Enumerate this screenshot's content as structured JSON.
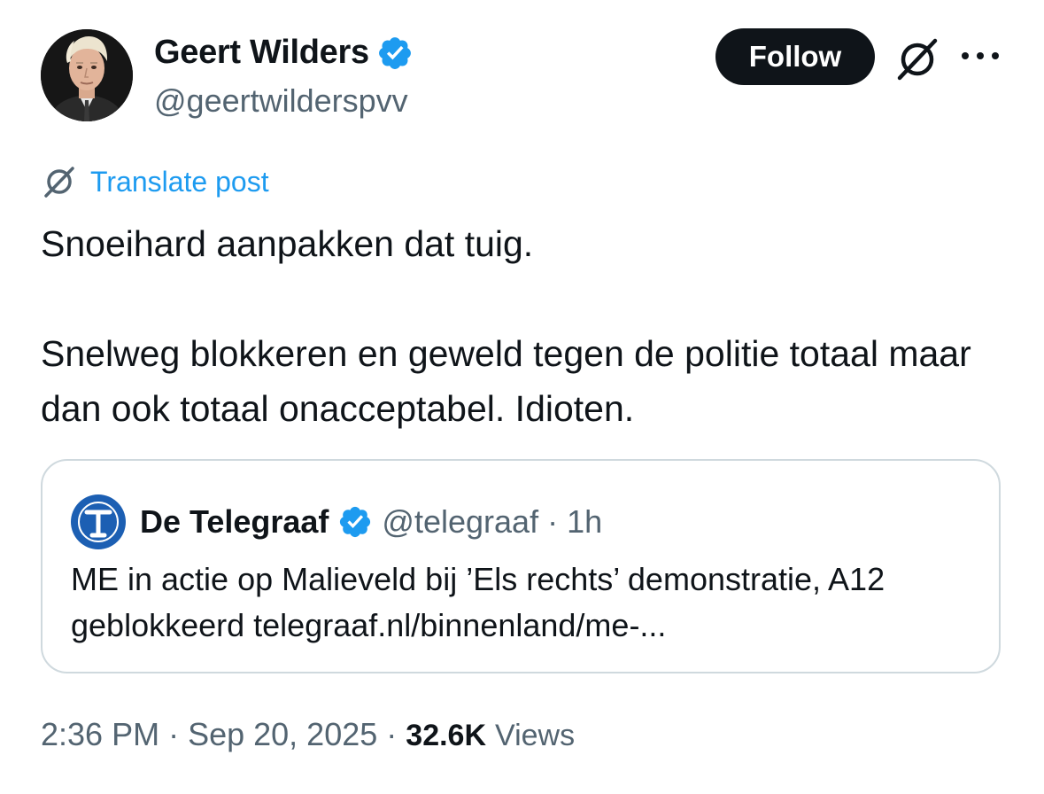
{
  "author": {
    "name": "Geert Wilders",
    "handle": "@geertwilderspvv"
  },
  "actions": {
    "follow_label": "Follow"
  },
  "icons": {
    "verified": "verified-badge-icon",
    "grok": "grok-icon",
    "more": "more-icon",
    "translate": "translate-icon"
  },
  "translate": {
    "label": "Translate post"
  },
  "post": {
    "line1": "Snoeihard aanpakken dat tuig.",
    "line2": "Snelweg blokkeren en geweld tegen de politie totaal maar dan ook totaal onacceptabel. Idioten."
  },
  "quoted": {
    "name": "De Telegraaf",
    "handle": "@telegraaf",
    "separator": "·",
    "time": "1h",
    "text": "ME in actie op Malieveld bij ’Els rechts’ demonstratie, A12 geblokkeerd telegraaf.nl/binnenland/me-..."
  },
  "meta": {
    "time": "2:36 PM",
    "sep1": "·",
    "date": "Sep 20, 2025",
    "sep2": "·",
    "views_count": "32.6K",
    "views_label": "Views"
  },
  "colors": {
    "text": "#0f1419",
    "secondary": "#536471",
    "link": "#1d9bf0",
    "verified": "#1d9bf0",
    "border": "#cfd9de",
    "button_bg": "#0f1419"
  }
}
